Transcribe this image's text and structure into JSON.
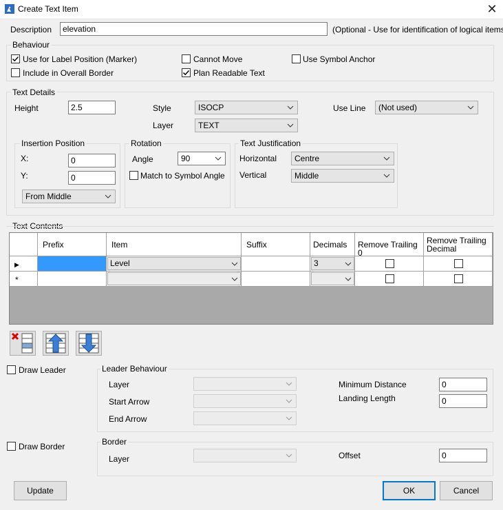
{
  "window": {
    "title": "Create Text Item",
    "close_label": "✕"
  },
  "description": {
    "label": "Description",
    "value": "elevation",
    "hint": "(Optional - Use for identification of logical items)"
  },
  "behaviour": {
    "title": "Behaviour",
    "use_label_position": {
      "label": "Use for Label Position (Marker)",
      "checked": true
    },
    "cannot_move": {
      "label": "Cannot Move",
      "checked": false
    },
    "use_symbol_anchor": {
      "label": "Use Symbol Anchor",
      "checked": false
    },
    "include_in_border": {
      "label": "Include in Overall Border",
      "checked": false
    },
    "plan_readable": {
      "label": "Plan Readable Text",
      "checked": true
    }
  },
  "text_details": {
    "title": "Text Details",
    "height_label": "Height",
    "height_value": "2.5",
    "style_label": "Style",
    "style_value": "ISOCP",
    "layer_label": "Layer",
    "layer_value": "TEXT",
    "use_line_label": "Use Line",
    "use_line_value": "(Not used)",
    "insertion": {
      "title": "Insertion Position",
      "x_label": "X:",
      "x_value": "0",
      "y_label": "Y:",
      "y_value": "0",
      "from_value": "From Middle"
    },
    "rotation": {
      "title": "Rotation",
      "angle_label": "Angle",
      "angle_value": "90",
      "match_label": "Match to Symbol Angle",
      "match_checked": false
    },
    "justification": {
      "title": "Text Justification",
      "horizontal_label": "Horizontal",
      "horizontal_value": "Centre",
      "vertical_label": "Vertical",
      "vertical_value": "Middle"
    }
  },
  "text_contents": {
    "title": "Text Contents",
    "columns": [
      "Prefix",
      "Item",
      "Suffix",
      "Decimals",
      "Remove Trailing 0",
      "Remove Trailing Decimal"
    ],
    "rows": [
      {
        "marker": "▶",
        "prefix": "",
        "item": "Level",
        "suffix": "",
        "decimals": "3",
        "remove_trailing_0": false,
        "remove_trailing_decimal": false
      },
      {
        "marker": "*",
        "prefix": "",
        "item": "",
        "suffix": "",
        "decimals": "",
        "remove_trailing_0": false,
        "remove_trailing_decimal": false
      }
    ],
    "tools": [
      "delete-row-icon",
      "move-up-icon",
      "move-down-icon"
    ]
  },
  "leader": {
    "draw_label": "Draw Leader",
    "draw_checked": false,
    "title": "Leader Behaviour",
    "layer_label": "Layer",
    "start_arrow_label": "Start Arrow",
    "end_arrow_label": "End Arrow",
    "min_distance_label": "Minimum Distance",
    "min_distance_value": "0",
    "landing_length_label": "Landing Length",
    "landing_length_value": "0"
  },
  "border": {
    "draw_label": "Draw Border",
    "draw_checked": false,
    "title": "Border",
    "layer_label": "Layer",
    "offset_label": "Offset",
    "offset_value": "0"
  },
  "buttons": {
    "update": "Update",
    "ok": "OK",
    "cancel": "Cancel"
  },
  "colors": {
    "selection": "#3399ff",
    "grid_bg": "#a9a9a9"
  }
}
